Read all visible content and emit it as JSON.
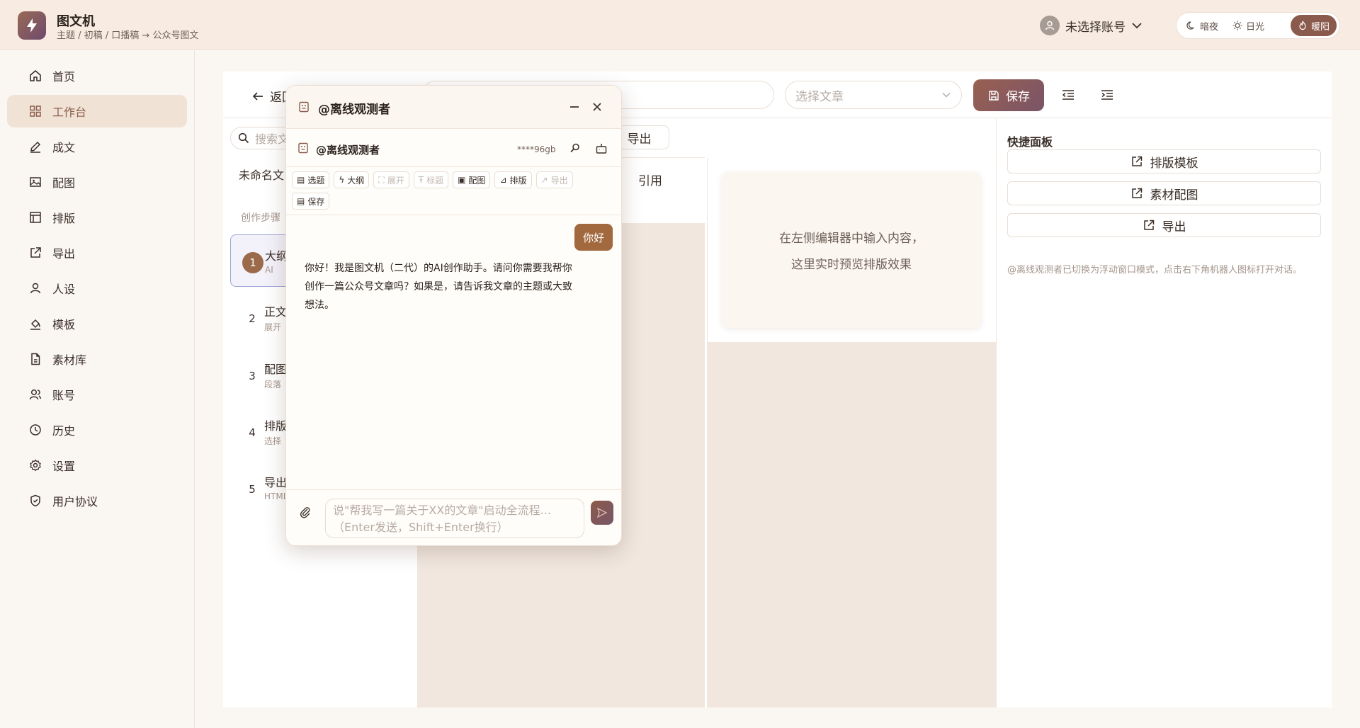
{
  "app": {
    "title": "图文机",
    "breadcrumb": "主题 / 初稿 / 口播稿 → 公众号图文"
  },
  "account": {
    "label": "未选择账号"
  },
  "themes": [
    {
      "label": "暗夜",
      "icon": "moon-icon"
    },
    {
      "label": "日光",
      "icon": "sun-icon"
    },
    {
      "label": "暖阳",
      "icon": "flame-icon",
      "active": true
    }
  ],
  "sidebar": {
    "items": [
      {
        "label": "首页",
        "icon": "home-icon"
      },
      {
        "label": "工作台",
        "icon": "grid-icon",
        "active": true
      },
      {
        "label": "成文",
        "icon": "pen-icon"
      },
      {
        "label": "配图",
        "icon": "image-icon"
      },
      {
        "label": "排版",
        "icon": "layout-icon"
      },
      {
        "label": "导出",
        "icon": "export-icon"
      },
      {
        "label": "人设",
        "icon": "user-icon"
      },
      {
        "label": "模板",
        "icon": "paint-bucket-icon"
      },
      {
        "label": "素材库",
        "icon": "file-icon"
      },
      {
        "label": "账号",
        "icon": "users-icon"
      },
      {
        "label": "历史",
        "icon": "clock-icon"
      },
      {
        "label": "设置",
        "icon": "gear-icon"
      },
      {
        "label": "用户协议",
        "icon": "shield-icon"
      }
    ]
  },
  "toolbar": {
    "back_label": "返回",
    "article_select_placeholder": "选择文章",
    "save_label": "保存"
  },
  "left_panel": {
    "search_placeholder": "搜索文",
    "article_name": "未命名文",
    "steps_label": "创作步骤",
    "steps": [
      {
        "num": "1",
        "title": "大纲",
        "sub": "AI",
        "active": true
      },
      {
        "num": "2",
        "title": "正文",
        "sub": "展开"
      },
      {
        "num": "3",
        "title": "配图",
        "sub": "段落"
      },
      {
        "num": "4",
        "title": "排版",
        "sub": "选择"
      },
      {
        "num": "5",
        "title": "导出",
        "sub": "HTML"
      }
    ]
  },
  "editor": {
    "export_chip": "导出",
    "cite_tab": "引用"
  },
  "preview": {
    "line1": "在左侧编辑器中输入内容，",
    "line2": "这里实时预览排版效果"
  },
  "quick_panel": {
    "title": "快捷面板",
    "buttons": [
      "排版模板",
      "素材配图",
      "导出"
    ],
    "hint": "@离线观测者已切换为浮动窗口模式，点击右下角机器人图标打开对话。"
  },
  "chat": {
    "window_title": "@离线观测者",
    "agent_name": "@离线观测者",
    "api_key_mask": "****96gb",
    "actions_row1": [
      {
        "label": "选题",
        "icon": "doc-icon",
        "disabled": false
      },
      {
        "label": "大纲",
        "icon": "bolt-icon",
        "disabled": false
      },
      {
        "label": "展开",
        "icon": "expand-icon",
        "disabled": true
      },
      {
        "label": "标题",
        "icon": "type-icon",
        "disabled": true
      },
      {
        "label": "配图",
        "icon": "image-icon",
        "disabled": false
      },
      {
        "label": "排版",
        "icon": "paint-bucket-icon",
        "disabled": false
      },
      {
        "label": "导出",
        "icon": "export-icon",
        "disabled": true
      }
    ],
    "actions_row2": [
      {
        "label": "保存",
        "icon": "save-icon",
        "disabled": false
      }
    ],
    "user_message": "你好",
    "ai_message": "你好！我是图文机（二代）的AI创作助手。请问你需要我帮你创作一篇公众号文章吗？如果是，请告诉我文章的主题或大致想法。",
    "input_placeholder_line1": "说\"帮我写一篇关于XX的文章\"启动全流程...",
    "input_placeholder_line2": "（Enter发送，Shift+Enter换行）"
  },
  "colors": {
    "accent": "#8a5a4c",
    "header_bg": "#f8ece2",
    "sidebar_active": "#f1e2d6",
    "editor_bg": "#f1e7df"
  }
}
